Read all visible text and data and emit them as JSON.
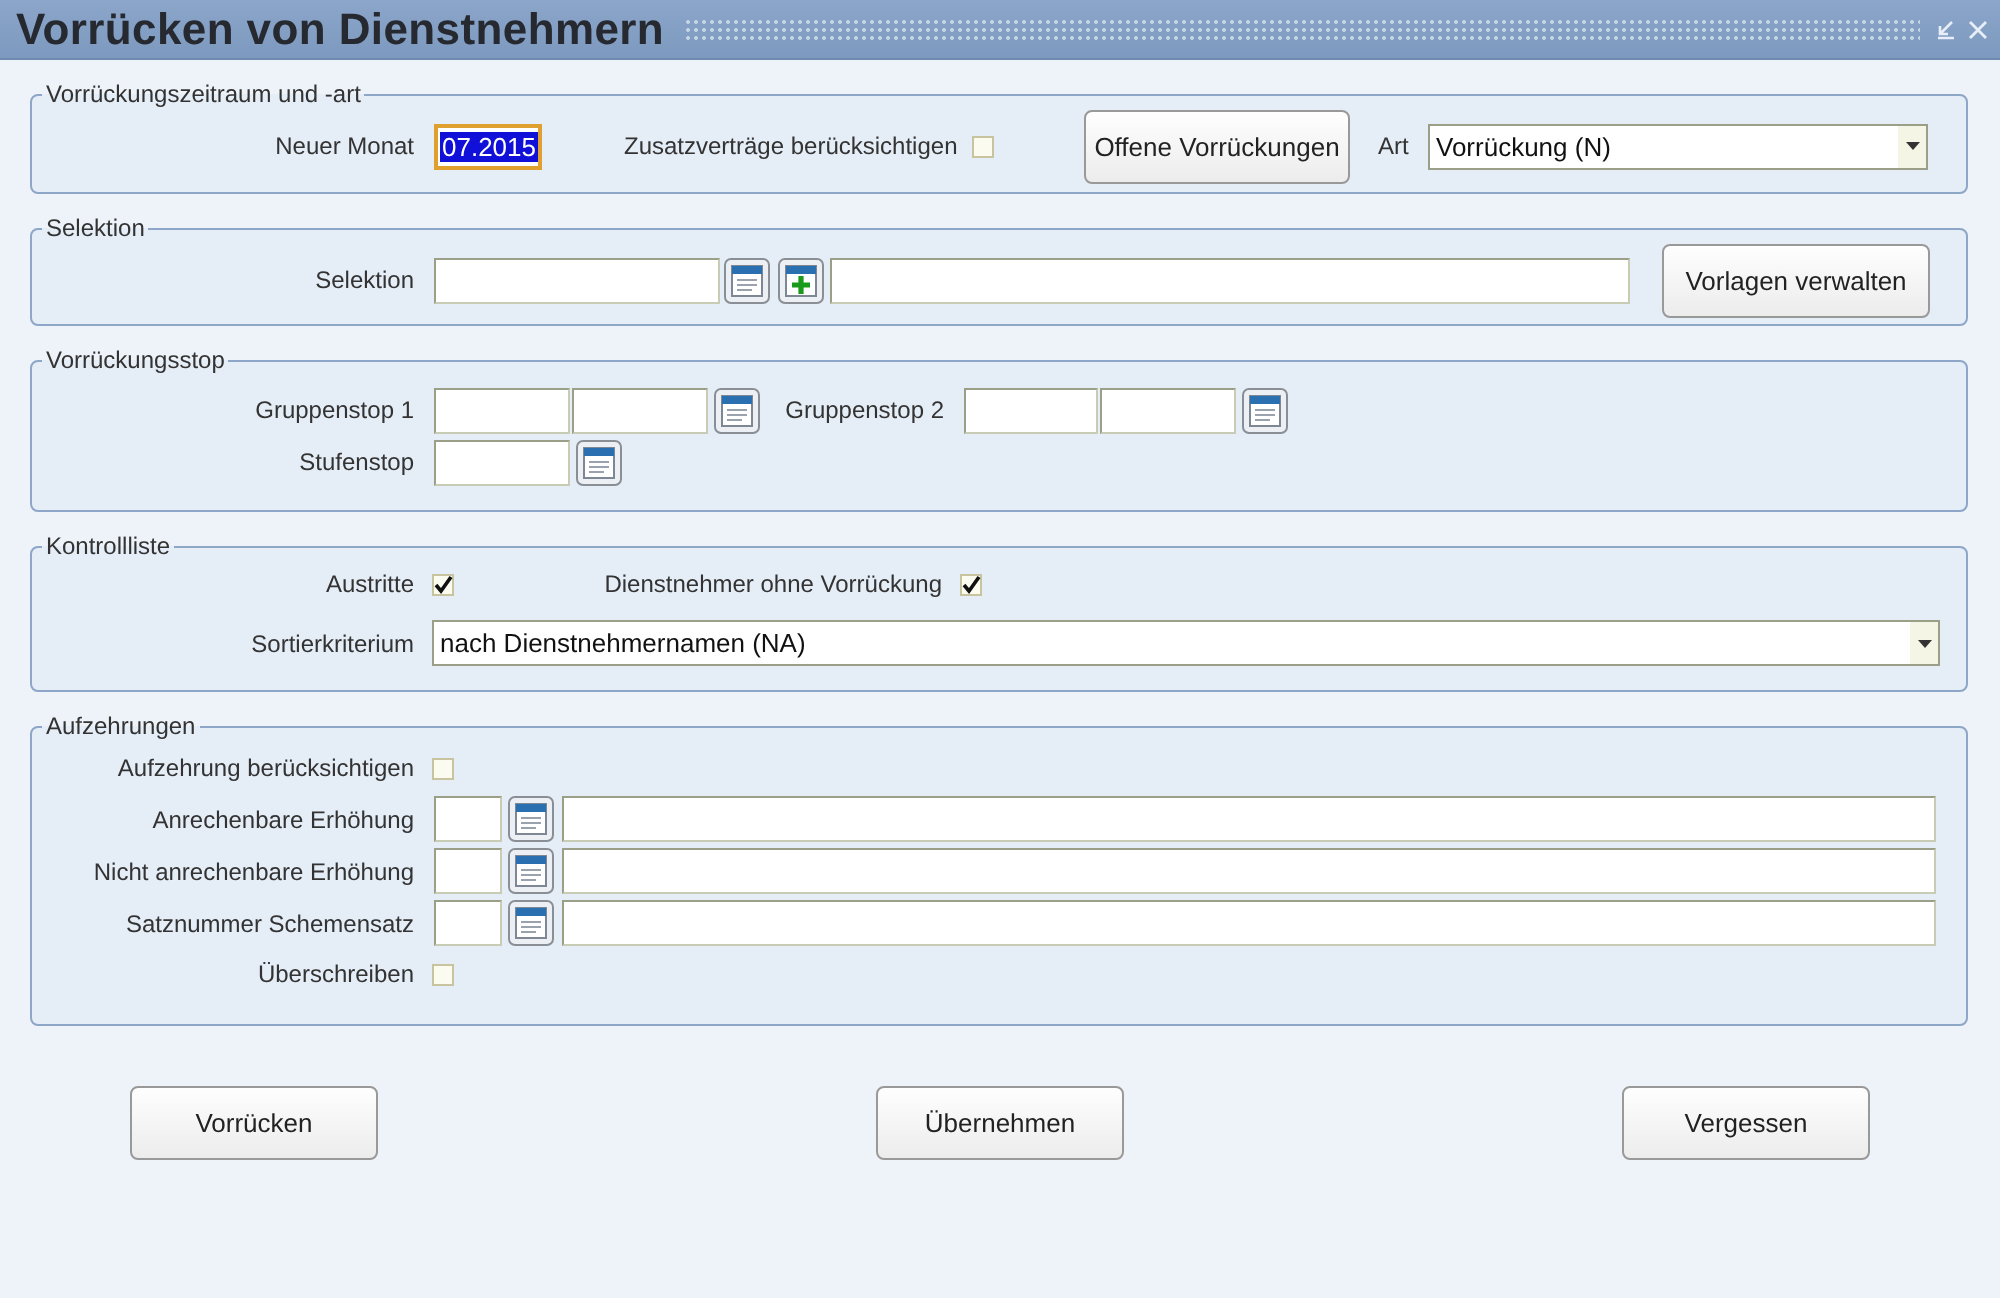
{
  "window": {
    "title": "Vorrücken von Dienstnehmern"
  },
  "sections": [
    {
      "legend": "Vorrückungszeitraum und -art",
      "rows": [
        {
          "items": [
            {
              "kind": "label",
              "text": "Neuer Monat"
            },
            {
              "kind": "field",
              "value": "07.2015",
              "focused": true
            },
            {
              "kind": "label",
              "text": "Zusatzverträge berücksichtigen"
            },
            {
              "kind": "checkbox",
              "checked": false
            },
            {
              "kind": "button",
              "text": "Offene Vorrückungen"
            },
            {
              "kind": "label",
              "text": "Art"
            },
            {
              "kind": "dropdown",
              "value": "Vorrückung (N)"
            }
          ]
        }
      ]
    },
    {
      "legend": "Selektion",
      "rows": [
        {
          "items": [
            {
              "kind": "label",
              "text": "Selektion"
            },
            {
              "kind": "field",
              "value": "",
              "focused": false
            },
            {
              "kind": "lookup"
            },
            {
              "kind": "add"
            },
            {
              "kind": "field",
              "value": "",
              "focused": false
            },
            {
              "kind": "button",
              "text": "Vorlagen verwalten"
            }
          ]
        }
      ]
    },
    {
      "legend": "Vorrückungsstop",
      "rows": [
        {
          "items": [
            {
              "kind": "label",
              "text": "Gruppenstop 1"
            },
            {
              "kind": "field",
              "value": "",
              "focused": false
            },
            {
              "kind": "field",
              "value": "",
              "focused": false
            },
            {
              "kind": "lookup"
            },
            {
              "kind": "label",
              "text": "Gruppenstop 2"
            },
            {
              "kind": "field",
              "value": "",
              "focused": false
            },
            {
              "kind": "field",
              "value": "",
              "focused": false
            },
            {
              "kind": "lookup"
            }
          ]
        },
        {
          "items": [
            {
              "kind": "label",
              "text": "Stufenstop"
            },
            {
              "kind": "field",
              "value": "",
              "focused": false
            },
            {
              "kind": "lookup"
            }
          ]
        }
      ]
    },
    {
      "legend": "Kontrollliste",
      "rows": [
        {
          "items": [
            {
              "kind": "label",
              "text": "Austritte"
            },
            {
              "kind": "checkbox",
              "checked": true
            },
            {
              "kind": "label",
              "text": "Dienstnehmer ohne Vorrückung"
            },
            {
              "kind": "checkbox",
              "checked": true
            }
          ]
        },
        {
          "items": [
            {
              "kind": "label",
              "text": "Sortierkriterium"
            },
            {
              "kind": "dropdown",
              "value": "nach Dienstnehmernamen (NA)"
            }
          ]
        }
      ]
    },
    {
      "legend": "Aufzehrungen",
      "rows": [
        {
          "items": [
            {
              "kind": "label",
              "text": "Aufzehrung berücksichtigen"
            },
            {
              "kind": "checkbox",
              "checked": false
            }
          ]
        },
        {
          "items": [
            {
              "kind": "label",
              "text": "Anrechenbare Erhöhung"
            },
            {
              "kind": "field",
              "value": "",
              "focused": false
            },
            {
              "kind": "lookup"
            },
            {
              "kind": "field",
              "value": "",
              "focused": false
            }
          ]
        },
        {
          "items": [
            {
              "kind": "label",
              "text": "Nicht anrechenbare Erhöhung"
            },
            {
              "kind": "field",
              "value": "",
              "focused": false
            },
            {
              "kind": "lookup"
            },
            {
              "kind": "field",
              "value": "",
              "focused": false
            }
          ]
        },
        {
          "items": [
            {
              "kind": "label",
              "text": "Satznummer Schemensatz"
            },
            {
              "kind": "field",
              "value": "",
              "focused": false
            },
            {
              "kind": "lookup"
            },
            {
              "kind": "field",
              "value": "",
              "focused": false
            }
          ]
        },
        {
          "items": [
            {
              "kind": "label",
              "text": "Überschreiben"
            },
            {
              "kind": "checkbox",
              "checked": false
            }
          ]
        }
      ]
    }
  ],
  "buttons": [
    {
      "label": "Vorrücken"
    },
    {
      "label": "Übernehmen"
    },
    {
      "label": "Vergessen"
    }
  ]
}
